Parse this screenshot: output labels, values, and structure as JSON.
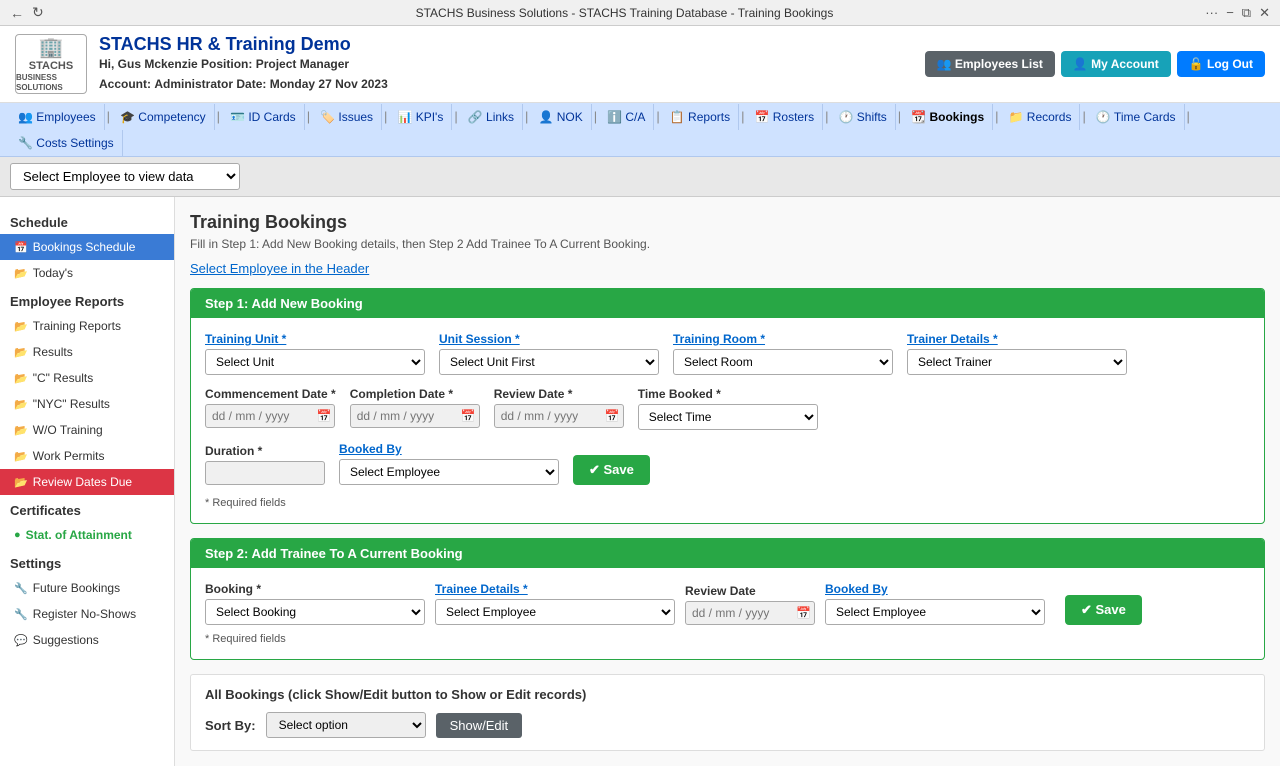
{
  "browser": {
    "title": "STACHS Business Solutions - STACHS Training Database - Training Bookings",
    "nav_back": "←",
    "nav_refresh": "↻",
    "menu_dots": "···",
    "minimize": "−",
    "restore": "⧉",
    "close": "✕"
  },
  "header": {
    "logo_text": "STACHS",
    "logo_sub": "BUSINESS SOLUTIONS",
    "app_title": "STACHS HR & Training Demo",
    "greeting": "Hi, Gus Mckenzie",
    "position_label": "Position:",
    "position_value": "Project Manager",
    "account_label": "Account:",
    "account_value": "Administrator",
    "date_label": "Date:",
    "date_value": "Monday 27 Nov 2023",
    "btn_employees": "👥 Employees List",
    "btn_account": "👤 My Account",
    "btn_logout": "🔓 Log Out"
  },
  "nav": {
    "items": [
      {
        "icon": "👥",
        "label": "Employees"
      },
      {
        "icon": "🎓",
        "label": "Competency"
      },
      {
        "icon": "🪪",
        "label": "ID Cards"
      },
      {
        "icon": "🏷️",
        "label": "Issues"
      },
      {
        "icon": "📊",
        "label": "KPI's"
      },
      {
        "icon": "🔗",
        "label": "Links"
      },
      {
        "icon": "👤",
        "label": "NOK"
      },
      {
        "icon": "ℹ️",
        "label": "C/A"
      },
      {
        "icon": "📋",
        "label": "Reports"
      },
      {
        "icon": "📅",
        "label": "Rosters"
      },
      {
        "icon": "🕐",
        "label": "Shifts"
      },
      {
        "icon": "📆",
        "label": "Bookings",
        "active": true
      },
      {
        "icon": "📁",
        "label": "Records"
      },
      {
        "icon": "🕐",
        "label": "Time Cards"
      },
      {
        "icon": "🔧",
        "label": "Costs Settings"
      }
    ]
  },
  "employee_selector": {
    "placeholder": "Select Employee to view data",
    "options": [
      "Select Employee to view data"
    ]
  },
  "sidebar": {
    "schedule_title": "Schedule",
    "schedule_items": [
      {
        "icon": "📅",
        "label": "Bookings Schedule",
        "active": true
      },
      {
        "icon": "📂",
        "label": "Today's"
      }
    ],
    "employee_reports_title": "Employee Reports",
    "employee_reports_items": [
      {
        "icon": "📂",
        "label": "Training Reports"
      },
      {
        "icon": "📂",
        "label": "Results"
      },
      {
        "icon": "📂",
        "label": "\"C\" Results"
      },
      {
        "icon": "📂",
        "label": "\"NYC\" Results"
      },
      {
        "icon": "📂",
        "label": "W/O Training"
      },
      {
        "icon": "📂",
        "label": "Work Permits"
      },
      {
        "icon": "📂",
        "label": "Review Dates Due",
        "danger": true
      }
    ],
    "certificates_title": "Certificates",
    "certificates_items": [
      {
        "icon": "●",
        "label": "Stat. of Attainment",
        "green": true
      }
    ],
    "settings_title": "Settings",
    "settings_items": [
      {
        "icon": "🔧",
        "label": "Future Bookings"
      },
      {
        "icon": "🔧",
        "label": "Register No-Shows"
      },
      {
        "icon": "💬",
        "label": "Suggestions"
      }
    ]
  },
  "content": {
    "page_title": "Training Bookings",
    "page_subtitle": "Fill in Step 1: Add New Booking details, then Step 2 Add Trainee To A Current Booking.",
    "select_employee_link": "Select Employee in the Header",
    "step1": {
      "header": "Step 1: Add New Booking",
      "training_unit_label": "Training Unit *",
      "training_unit_options": [
        "Select Unit"
      ],
      "unit_session_label": "Unit Session *",
      "unit_session_options": [
        "Select Unit First"
      ],
      "training_room_label": "Training Room *",
      "training_room_options": [
        "Select Room"
      ],
      "trainer_details_label": "Trainer Details *",
      "trainer_details_options": [
        "Select Trainer"
      ],
      "commencement_date_label": "Commencement Date *",
      "commencement_date_placeholder": "dd / mm / yyyy",
      "completion_date_label": "Completion Date *",
      "completion_date_placeholder": "dd / mm / yyyy",
      "review_date_label": "Review Date *",
      "review_date_placeholder": "dd / mm / yyyy",
      "time_booked_label": "Time Booked *",
      "time_booked_options": [
        "Select Time"
      ],
      "duration_label": "Duration *",
      "booked_by_label": "Booked By",
      "booked_by_options": [
        "Select Employee"
      ],
      "save_btn": "✔ Save",
      "required_note": "* Required fields"
    },
    "step2": {
      "header": "Step 2: Add Trainee To A Current Booking",
      "booking_label": "Booking *",
      "booking_options": [
        "Select Booking"
      ],
      "trainee_details_label": "Trainee Details *",
      "trainee_details_options": [
        "Select Employee"
      ],
      "review_date_label": "Review Date",
      "review_date_placeholder": "dd / mm / yyyy",
      "booked_by_label": "Booked By",
      "booked_by_options": [
        "Select Employee"
      ],
      "save_btn": "✔ Save",
      "required_note": "* Required fields"
    },
    "all_bookings": {
      "title": "All Bookings (click Show/Edit button to Show or Edit records)",
      "sort_by_label": "Sort By:",
      "sort_options": [
        "Select option"
      ],
      "show_edit_btn": "Show/Edit"
    }
  }
}
